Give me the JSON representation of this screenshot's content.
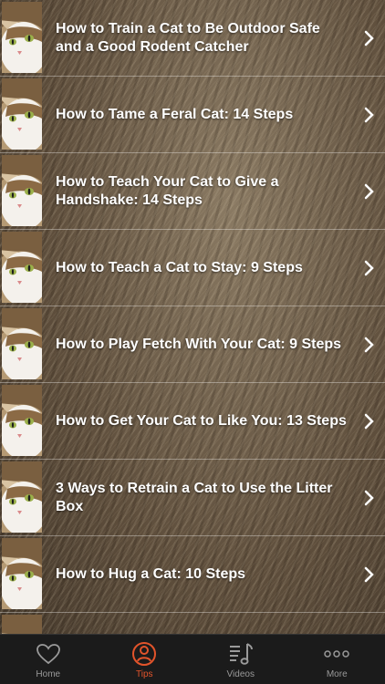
{
  "articles": [
    {
      "title": "How to Train a Cat to Be Outdoor Safe and a Good Rodent Catcher"
    },
    {
      "title": "How to Tame a Feral Cat: 14 Steps"
    },
    {
      "title": "How to Teach Your Cat to Give a Handshake: 14 Steps"
    },
    {
      "title": "How to Teach a Cat to Stay: 9 Steps"
    },
    {
      "title": "How to Play Fetch With Your Cat: 9 Steps"
    },
    {
      "title": "How to Get Your Cat to Like You: 13 Steps"
    },
    {
      "title": "3 Ways to Retrain a Cat to Use the Litter Box"
    },
    {
      "title": "How to Hug a Cat: 10 Steps"
    }
  ],
  "tabbar": {
    "home": {
      "label": "Home",
      "icon": "heart-icon"
    },
    "tips": {
      "label": "Tips",
      "icon": "person-circle-icon"
    },
    "videos": {
      "label": "Videos",
      "icon": "music-note-list-icon"
    },
    "more": {
      "label": "More",
      "icon": "three-dots-icon"
    },
    "active_color": "#e2542b",
    "inactive_color": "#9a9a9a"
  }
}
